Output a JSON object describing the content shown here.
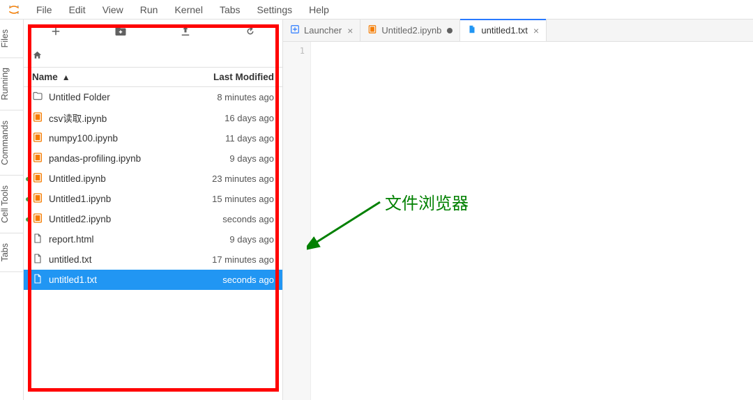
{
  "menubar": [
    "File",
    "Edit",
    "View",
    "Run",
    "Kernel",
    "Tabs",
    "Settings",
    "Help"
  ],
  "rail_tabs": [
    "Files",
    "Running",
    "Commands",
    "Cell Tools",
    "Tabs"
  ],
  "file_header": {
    "name": "Name",
    "modified": "Last Modified"
  },
  "files": [
    {
      "icon": "folder",
      "name": "Untitled Folder",
      "modified": "8 minutes ago",
      "running": false,
      "selected": false
    },
    {
      "icon": "notebook",
      "name": "csv读取.ipynb",
      "modified": "16 days ago",
      "running": false,
      "selected": false
    },
    {
      "icon": "notebook",
      "name": "numpy100.ipynb",
      "modified": "11 days ago",
      "running": false,
      "selected": false
    },
    {
      "icon": "notebook",
      "name": "pandas-profiling.ipynb",
      "modified": "9 days ago",
      "running": false,
      "selected": false
    },
    {
      "icon": "notebook",
      "name": "Untitled.ipynb",
      "modified": "23 minutes ago",
      "running": true,
      "selected": false
    },
    {
      "icon": "notebook",
      "name": "Untitled1.ipynb",
      "modified": "15 minutes ago",
      "running": true,
      "selected": false
    },
    {
      "icon": "notebook",
      "name": "Untitled2.ipynb",
      "modified": "seconds ago",
      "running": true,
      "selected": false
    },
    {
      "icon": "file",
      "name": "report.html",
      "modified": "9 days ago",
      "running": false,
      "selected": false
    },
    {
      "icon": "file",
      "name": "untitled.txt",
      "modified": "17 minutes ago",
      "running": false,
      "selected": false
    },
    {
      "icon": "file",
      "name": "untitled1.txt",
      "modified": "seconds ago",
      "running": false,
      "selected": true
    }
  ],
  "tabs": [
    {
      "icon": "launcher",
      "label": "Launcher",
      "state": "close"
    },
    {
      "icon": "notebook",
      "label": "Untitled2.ipynb",
      "state": "unsaved"
    },
    {
      "icon": "textfile",
      "label": "untitled1.txt",
      "state": "close",
      "active": true
    }
  ],
  "gutter": [
    "1"
  ],
  "annotation": {
    "label": "文件浏览器"
  },
  "colors": {
    "selection": "#2196f3",
    "accent": "#2979ff",
    "notebook_icon": "#f57c00",
    "file_icon": "#616161",
    "textfile_icon": "#2196f3",
    "running_dot": "#43a047",
    "annotation": "#008000"
  }
}
